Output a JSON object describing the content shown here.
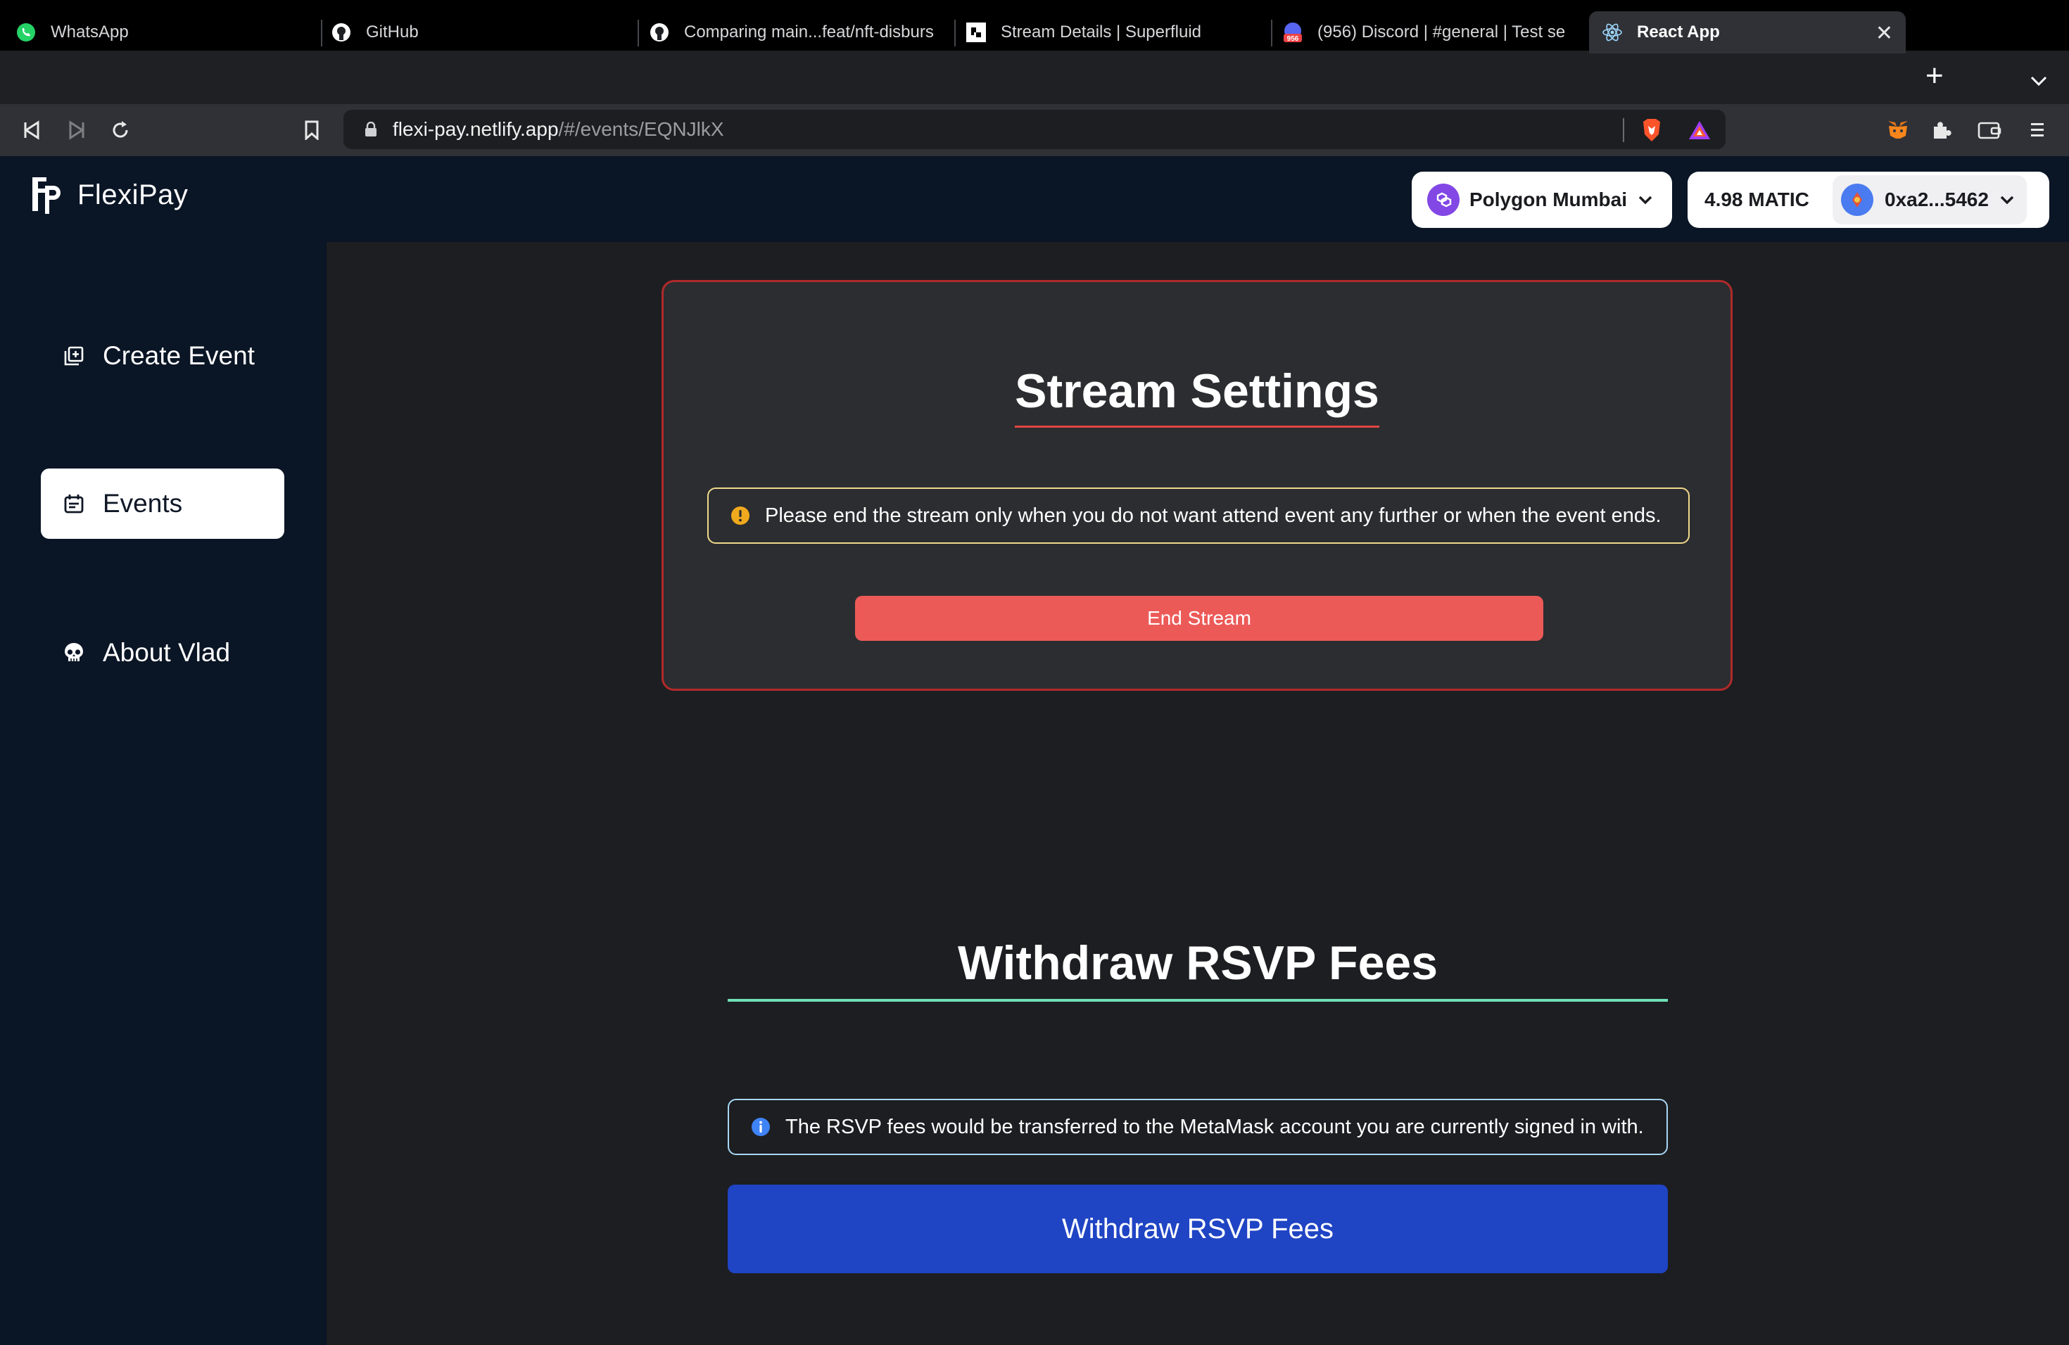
{
  "browser": {
    "tabs": [
      {
        "label": "WhatsApp",
        "icon": "whatsapp-icon"
      },
      {
        "label": "GitHub",
        "icon": "github-icon"
      },
      {
        "label": "Comparing main...feat/nft-disburs",
        "icon": "github-icon"
      },
      {
        "label": "Stream Details | Superfluid",
        "icon": "superfluid-icon"
      },
      {
        "label": "(956) Discord | #general | Test se",
        "icon": "discord-icon",
        "badge": "956"
      },
      {
        "label": "React App",
        "icon": "react-icon",
        "active": true
      }
    ],
    "url": {
      "host": "flexi-pay.netlify.app",
      "path": "/#/events/EQNJlkX"
    }
  },
  "app": {
    "brand": "FlexiPay",
    "network": "Polygon Mumbai",
    "balance": "4.98 MATIC",
    "account": "0xa2...5462"
  },
  "sidebar": {
    "items": [
      {
        "label": "Create Event",
        "icon": "create-event-icon"
      },
      {
        "label": "Events",
        "icon": "calendar-icon",
        "active": true
      },
      {
        "label": "About Vlad",
        "icon": "skull-icon"
      }
    ]
  },
  "stream": {
    "title": "Stream Settings",
    "warning": "Please end the stream only when you do not want attend event any further or when the event ends.",
    "end_button": "End Stream"
  },
  "withdraw": {
    "title": "Withdraw RSVP Fees",
    "info": "The RSVP fees would be transferred to the MetaMask account you are currently signed in with.",
    "button": "Withdraw RSVP Fees"
  },
  "colors": {
    "sidebar_bg": "#0a1525",
    "main_bg": "#1d1e21",
    "card_border": "#b02a2a",
    "end_button": "#ec5a58",
    "withdraw_button": "#1f44c4",
    "withdraw_underline": "#6ee0b6"
  }
}
